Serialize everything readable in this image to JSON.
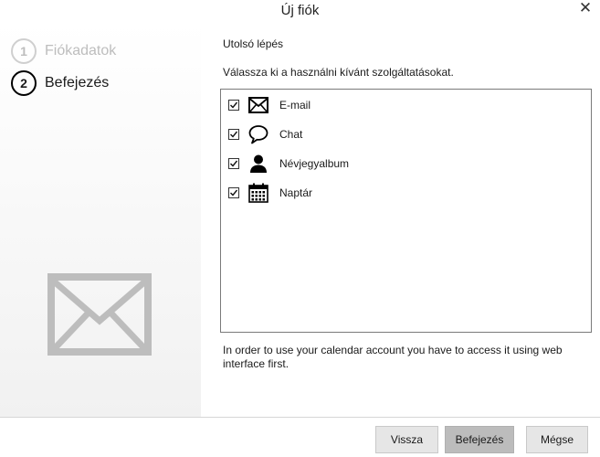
{
  "window": {
    "title": "Új fiók",
    "close_glyph": "✕"
  },
  "steps": [
    {
      "number": "1",
      "label": "Fiókadatok",
      "active": false
    },
    {
      "number": "2",
      "label": "Befejezés",
      "active": true
    }
  ],
  "main": {
    "heading": "Utolsó lépés",
    "instruction": "Válassza ki a használni kívánt szolgáltatásokat.",
    "services": [
      {
        "label": "E-mail",
        "icon": "envelope-icon",
        "checked": true
      },
      {
        "label": "Chat",
        "icon": "chat-bubble-icon",
        "checked": true
      },
      {
        "label": "Névjegyalbum",
        "icon": "person-icon",
        "checked": true
      },
      {
        "label": "Naptár",
        "icon": "calendar-icon",
        "checked": true
      }
    ],
    "note": "In order to use your calendar account you have to access it using web interface first."
  },
  "buttons": {
    "back": "Vissza",
    "finish": "Befejezés",
    "cancel": "Mégse"
  },
  "colors": {
    "sidebar_gradient_end": "#f1f1f1",
    "primary_button": "#bcbcbc",
    "button": "#e6e6e6",
    "illustration": "#bdbdbd"
  }
}
